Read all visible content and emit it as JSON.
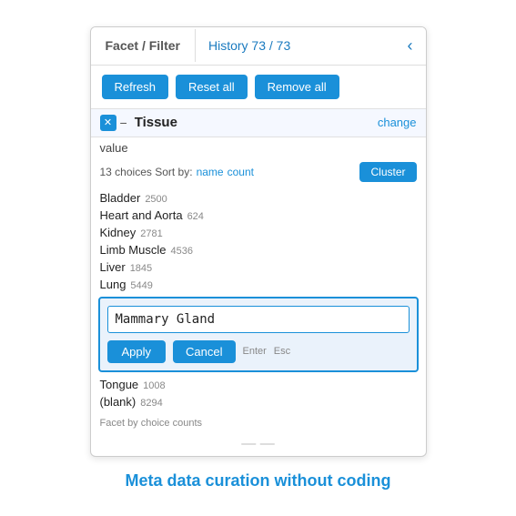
{
  "header": {
    "tab_facet_label": "Facet / Filter",
    "tab_history_label": "History 73 / 73",
    "chevron": "‹"
  },
  "toolbar": {
    "refresh_label": "Refresh",
    "reset_label": "Reset all",
    "remove_label": "Remove all"
  },
  "facet": {
    "title": "Tissue",
    "change_label": "change",
    "value_label": "value",
    "sort_prefix": "13 choices  Sort by:",
    "sort_name": "name",
    "sort_count": "count",
    "cluster_label": "Cluster"
  },
  "choices": [
    {
      "name": "Bladder",
      "count": "2500"
    },
    {
      "name": "Heart and Aorta",
      "count": "624"
    },
    {
      "name": "Kidney",
      "count": "2781"
    },
    {
      "name": "Limb Muscle",
      "count": "4536"
    },
    {
      "name": "Liver",
      "count": "1845"
    },
    {
      "name": "Lung",
      "count": "5449"
    }
  ],
  "edit_overlay": {
    "input_value": "Mammary Gland",
    "apply_label": "Apply",
    "cancel_label": "Cancel",
    "apply_hint": "Enter",
    "cancel_hint": "Esc"
  },
  "choices_bottom": [
    {
      "name": "Tongue",
      "count": "1008"
    }
  ],
  "blank_row": {
    "name": "(blank)",
    "count": "8294"
  },
  "footer_text": "Facet by choice counts",
  "tagline": "Meta data curation without coding"
}
